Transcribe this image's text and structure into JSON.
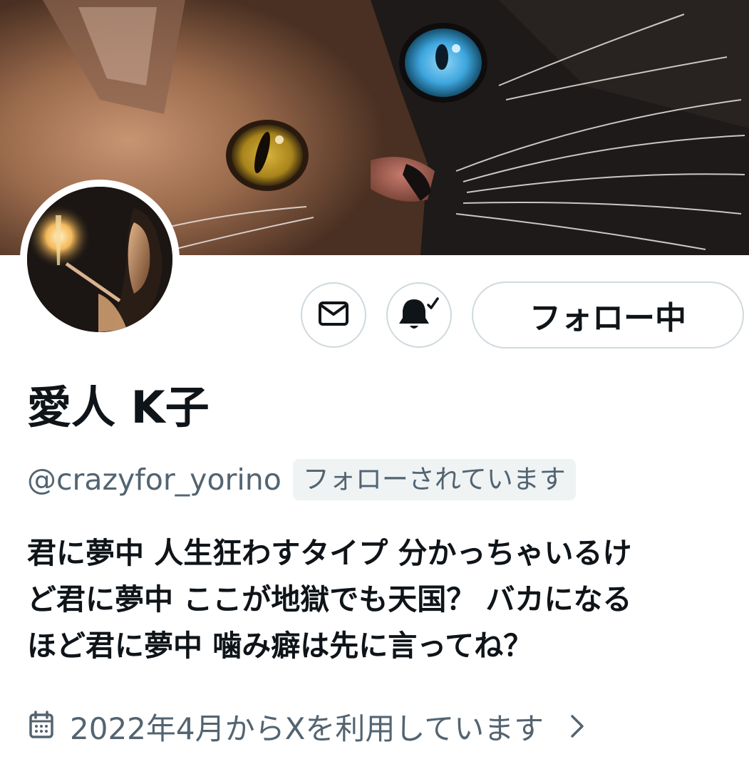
{
  "profile": {
    "display_name": "愛人 K子",
    "handle": "@crazyfor_yorino",
    "follows_you_badge": "フォローされています",
    "bio_lines": [
      "君に夢中 人生狂わすタイプ 分かっちゃいるけ",
      "ど君に夢中 ここが地獄でも天国？ バカになる",
      "ほど君に夢中 噛み癖は先に言ってね？"
    ],
    "joined": "2022年4月からXを利用しています"
  },
  "actions": {
    "follow_state_label": "フォロー中"
  },
  "icons": {
    "message": "envelope-icon",
    "notifications": "bell-check-icon",
    "calendar": "calendar-icon",
    "chevron": "chevron-right-icon"
  },
  "colors": {
    "text_primary": "#0f1419",
    "text_secondary": "#536471",
    "border": "#cfd9de",
    "badge_bg": "#eff3f4"
  }
}
